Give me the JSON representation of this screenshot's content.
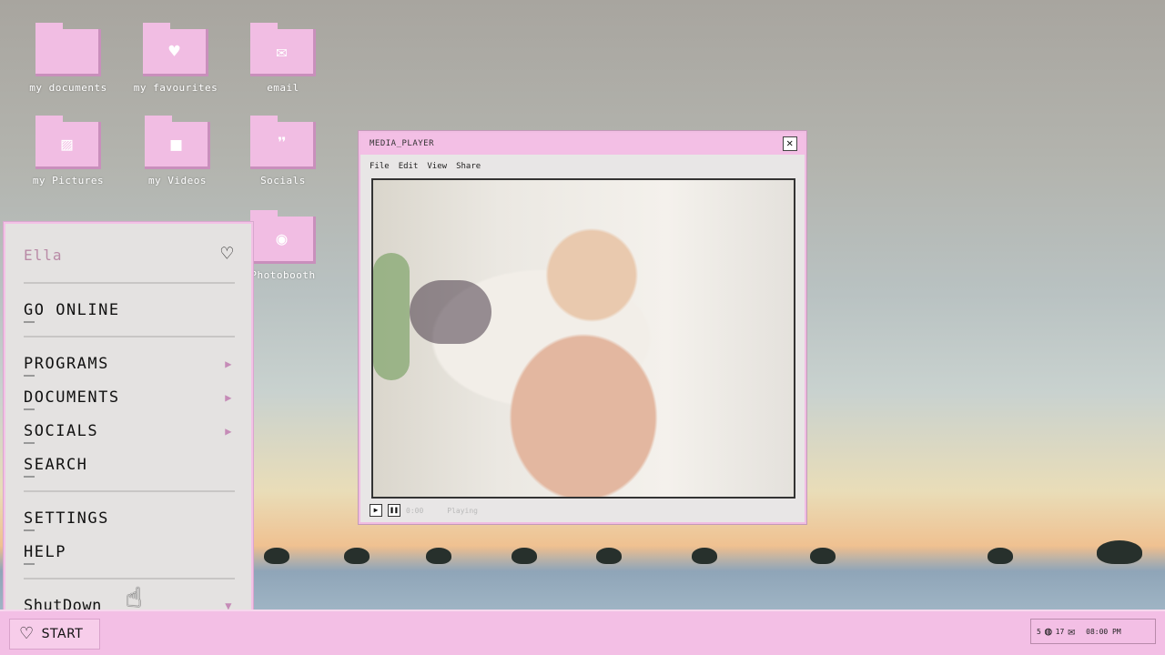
{
  "desktop": {
    "icons": [
      {
        "label": "my documents",
        "glyph": "folder-icon"
      },
      {
        "label": "my favourites",
        "glyph": "heart-folder-icon"
      },
      {
        "label": "email",
        "glyph": "envelope-icon"
      },
      {
        "label": "my Pictures",
        "glyph": "picture-folder-icon"
      },
      {
        "label": "my Videos",
        "glyph": "video-folder-icon"
      },
      {
        "label": "Socials",
        "glyph": "quote-folder-icon"
      },
      {
        "label": "Photobooth",
        "glyph": "camera-folder-icon"
      }
    ]
  },
  "start_menu": {
    "user": "Ella",
    "items": {
      "go_online": "GO ONLINE",
      "programs": "PROGRAMS",
      "documents": "DOCUMENTS",
      "socials": "SOCIALS",
      "search": "SEARCH",
      "settings": "SETTINGS",
      "help": "HELP",
      "shutdown": "ShutDown"
    }
  },
  "media_player": {
    "title": "MEDIA_PLAYER",
    "menu": [
      "File",
      "Edit",
      "View",
      "Share"
    ],
    "time": "0:00",
    "status": "Playing"
  },
  "taskbar": {
    "start_label": "START",
    "tray_count_a": "5",
    "tray_count_b": "17",
    "clock": "08:00 PM"
  },
  "colors": {
    "accent_pink": "#f3bfe5",
    "menu_bg": "#e4e2e1"
  }
}
